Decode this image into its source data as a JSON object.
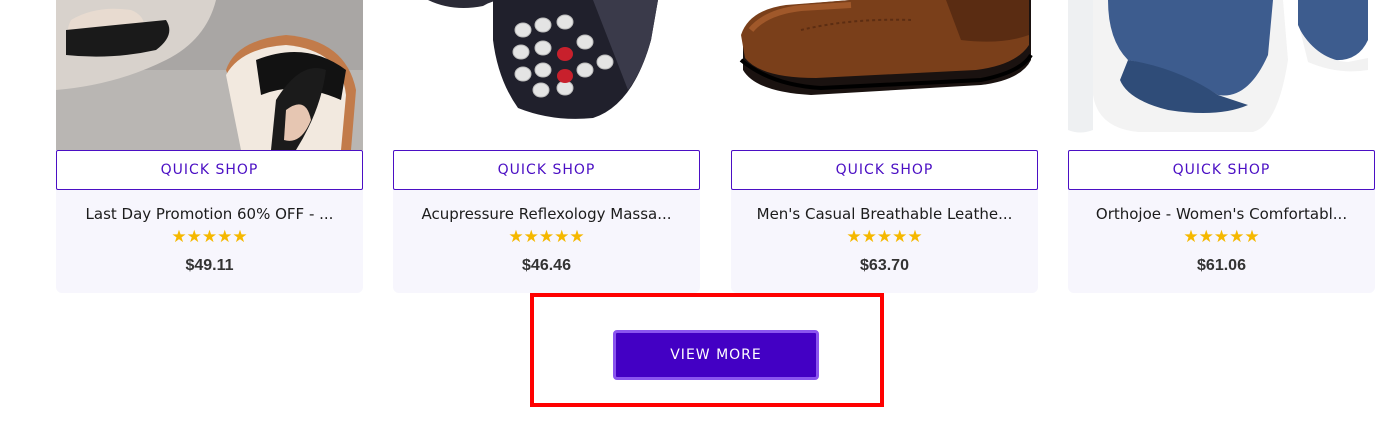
{
  "colors": {
    "accent": "#4b0fc4",
    "button_bg": "#4300c4",
    "card_bg": "#f7f6fd",
    "star": "#f5b800",
    "highlight": "#ff0000"
  },
  "products": [
    {
      "image_icon": "sandal-image",
      "quick_shop": "QUICK SHOP",
      "title": "Last Day Promotion 60% OFF - ...",
      "stars": "★★★★★",
      "rating": 5,
      "price": "$49.11"
    },
    {
      "image_icon": "massage-slipper-image",
      "quick_shop": "QUICK SHOP",
      "title": "Acupressure Reflexology Massa...",
      "stars": "★★★★★",
      "rating": 5,
      "price": "$46.46"
    },
    {
      "image_icon": "leather-loafer-image",
      "quick_shop": "QUICK SHOP",
      "title": "Men's Casual Breathable Leathe...",
      "stars": "★★★★★",
      "rating": 5,
      "price": "$63.70"
    },
    {
      "image_icon": "knit-sandal-image",
      "quick_shop": "QUICK SHOP",
      "title": "Orthojoe - Women's Comfortabl...",
      "stars": "★★★★★",
      "rating": 5,
      "price": "$61.06"
    }
  ],
  "view_more": {
    "label": "VIEW MORE"
  }
}
